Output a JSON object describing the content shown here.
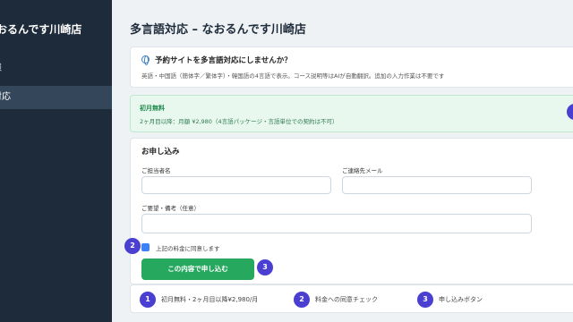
{
  "sidebar": {
    "brand": "おるんです川崎店",
    "items": [
      {
        "label": "報",
        "active": false
      },
      {
        "label": "対応",
        "active": true
      }
    ]
  },
  "page": {
    "title": "多言語対応 – なおるんです川崎店"
  },
  "info": {
    "title": "予約サイトを多言語対応にしませんか？",
    "description": "英語・中国語（簡体字／繁体字）・韓国語の4言語で表示。コース説明等はAIが自動翻訳。追加の入力作業は不要です",
    "icon": "globe-icon"
  },
  "promo": {
    "title": "初月無料",
    "description": "2ヶ月目以降：月額 ¥2,980（4言語パッケージ・言語単位での契約は不可）"
  },
  "form": {
    "title": "お申し込み",
    "contact_name_label": "ご担当者名",
    "contact_email_label": "ご連絡先メール",
    "notes_label": "ご要望・備考（任意）",
    "contact_name_value": "",
    "contact_email_value": "",
    "notes_value": "",
    "agree_label": "上記の料金に同意します",
    "agree_checked": true,
    "submit_label": "この内容で申し込む"
  },
  "badges": {
    "agree": "2",
    "submit": "3"
  },
  "legend": [
    {
      "number": "1",
      "text": "初月無料・2ヶ月目以降¥2,980/月"
    },
    {
      "number": "2",
      "text": "料金への同意チェック"
    },
    {
      "number": "3",
      "text": "申し込みボタン"
    }
  ],
  "colors": {
    "sidebar_bg": "#1e2b3a",
    "accent_green": "#27a85f",
    "step_badge": "#4a3fd0",
    "checkbox": "#3b82f6"
  }
}
